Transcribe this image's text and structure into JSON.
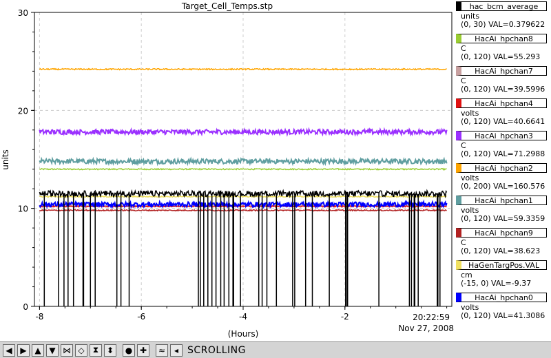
{
  "chart_data": {
    "type": "line",
    "title": "Target_Cell_Temps.stp",
    "xlabel": "(Hours)",
    "ylabel": "units",
    "xlim": [
      -8.1,
      0.1
    ],
    "ylim": [
      0,
      30
    ],
    "xticks": [
      "-8",
      "-6",
      "-4",
      "-2"
    ],
    "yticks": [
      "0",
      "10",
      "20",
      "30"
    ],
    "grid": true,
    "time_label": "20:22:59",
    "date_label": "Nov 27, 2008",
    "series": [
      {
        "name": "hac_bcm_average",
        "color": "#000000",
        "level": 11.5,
        "pattern": "dropouts"
      },
      {
        "name": "HacAi_hpchan8",
        "color": "#9acd32",
        "level": 14.0,
        "pattern": "flat"
      },
      {
        "name": "HacAi_hpchan7",
        "color": "#c8a0a0",
        "level": 10.3,
        "pattern": "flat"
      },
      {
        "name": "HacAi_hpchan4",
        "color": "#e01010",
        "level": 10.2,
        "pattern": "flat"
      },
      {
        "name": "HacAi_hpchan3",
        "color": "#9b30ff",
        "level": 17.8,
        "pattern": "noisy"
      },
      {
        "name": "HacAi_hpchan2",
        "color": "#ffa500",
        "level": 24.2,
        "pattern": "flat"
      },
      {
        "name": "HacAi_hpchan1",
        "color": "#5f9ea0",
        "level": 14.8,
        "pattern": "noisy"
      },
      {
        "name": "HacAi_hpchan9",
        "color": "#b22222",
        "level": 9.8,
        "pattern": "flat"
      },
      {
        "name": "HaGenTargPos.VAL",
        "color": "#f0e060",
        "level": 11.2,
        "pattern": "flat"
      },
      {
        "name": "HacAi_hpchan0",
        "color": "#0000ff",
        "level": 10.4,
        "pattern": "noisy"
      }
    ]
  },
  "legend": [
    {
      "name": "hac_bcm_average",
      "color": "#000000",
      "unit": "units",
      "range": "(0, 30) VAL=0.379622"
    },
    {
      "name": "HacAi_hpchan8",
      "color": "#9acd32",
      "unit": "C",
      "range": "(0, 120) VAL=55.293"
    },
    {
      "name": "HacAi_hpchan7",
      "color": "#c8a0a0",
      "unit": "C",
      "range": "(0, 120) VAL=39.5996"
    },
    {
      "name": "HacAi_hpchan4",
      "color": "#e01010",
      "unit": "volts",
      "range": "(0, 120) VAL=40.6641"
    },
    {
      "name": "HacAi_hpchan3",
      "color": "#9b30ff",
      "unit": "C",
      "range": "(0, 120) VAL=71.2988"
    },
    {
      "name": "HacAi_hpchan2",
      "color": "#ffa500",
      "unit": "volts",
      "range": "(0, 200) VAL=160.576"
    },
    {
      "name": "HacAi_hpchan1",
      "color": "#5f9ea0",
      "unit": "volts",
      "range": "(0, 120) VAL=59.3359"
    },
    {
      "name": "HacAi_hpchan9",
      "color": "#b22222",
      "unit": "C",
      "range": "(0, 120) VAL=38.623"
    },
    {
      "name": "HaGenTargPos.VAL",
      "color": "#f0e060",
      "unit": "cm",
      "range": "(-15, 0) VAL=-9.37"
    },
    {
      "name": "HacAi_hpchan0",
      "color": "#0000ff",
      "unit": "volts",
      "range": "(0, 120) VAL=41.3086"
    }
  ],
  "toolbar": {
    "buttons": [
      {
        "icon": "arrow-left-icon",
        "glyph": "◀"
      },
      {
        "icon": "arrow-right-icon",
        "glyph": "▶"
      },
      {
        "icon": "arrow-up-icon",
        "glyph": "▲"
      },
      {
        "icon": "arrow-down-icon",
        "glyph": "▼"
      },
      {
        "icon": "zoom-in-horizontal-icon",
        "glyph": "⋈"
      },
      {
        "icon": "zoom-out-horizontal-icon",
        "glyph": "◇"
      },
      {
        "icon": "zoom-in-vertical-icon",
        "glyph": "⧗"
      },
      {
        "icon": "zoom-out-vertical-icon",
        "glyph": "⬍"
      },
      {
        "icon": "record-icon",
        "glyph": "●"
      },
      {
        "icon": "add-icon",
        "glyph": "✚"
      },
      {
        "icon": "auto-scale-icon",
        "glyph": "≈"
      },
      {
        "icon": "scroll-toggle-icon",
        "glyph": "◂"
      }
    ],
    "status": "SCROLLING"
  }
}
